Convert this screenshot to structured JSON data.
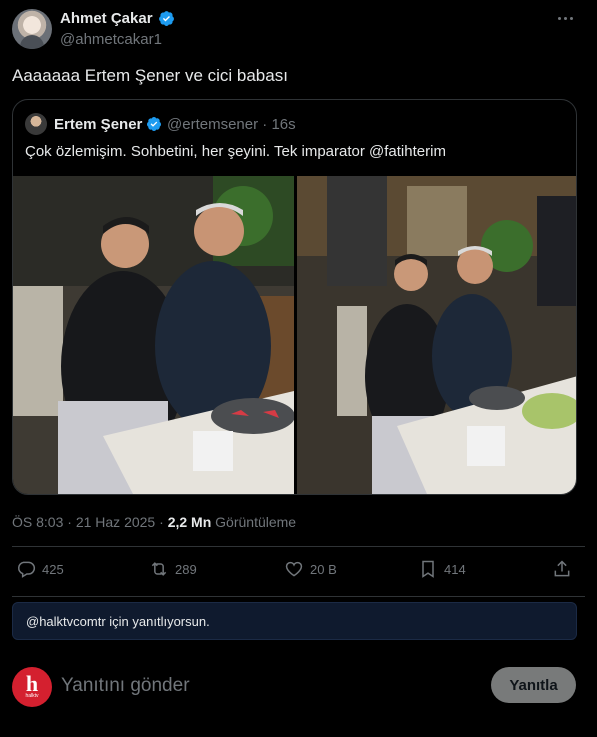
{
  "tweet": {
    "author_name": "Ahmet Çakar",
    "author_handle": "@ahmetcakar1",
    "text": "Aaaaaaa Ertem Şener ve cici babası",
    "time": "ÖS 8:03",
    "date": "21 Haz 2025",
    "views_count": "2,2 Mn",
    "views_label": "Görüntüleme"
  },
  "quote": {
    "author_name": "Ertem Şener",
    "author_handle": "@ertemsener",
    "age": "16s",
    "text": "Çok özlemişim. Sohbetini, her şeyini. Tek imparator @fatihterim"
  },
  "actions": {
    "replies": "425",
    "retweets": "289",
    "likes": "20 B",
    "bookmarks": "414"
  },
  "reply_banner": "@halktvcomtr için yanıtlıyorsun.",
  "composer": {
    "avatar_letter": "h",
    "avatar_sub": "halktv",
    "placeholder": "Yanıtını gönder",
    "button_label": "Yanıtla"
  },
  "colors": {
    "background": "#000000",
    "text": "#e7e9ea",
    "muted": "#71767b",
    "verified": "#1d9bf0",
    "reply_button_bg": "#787a7a",
    "halktv_red": "#d4202f"
  },
  "icons": [
    "more-icon",
    "verified-badge-icon",
    "reply-icon",
    "retweet-icon",
    "like-icon",
    "bookmark-icon",
    "share-icon"
  ]
}
